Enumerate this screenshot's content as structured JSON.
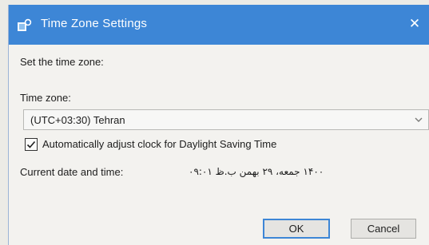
{
  "window": {
    "title": "Time Zone Settings",
    "close_glyph": "✕",
    "accent_color": "#3d86d6"
  },
  "content": {
    "heading": "Set the time zone:",
    "timezone_label": "Time zone:",
    "timezone_value": "(UTC+03:30) Tehran",
    "dst_label": "Automatically adjust clock for Daylight Saving Time",
    "dst_checked": true,
    "current_label": "Current date and time:",
    "current_value": "۱۴۰۰ جمعه، ۲۹ بهمن ب.ظ ۰۹:۰۱"
  },
  "buttons": {
    "ok": "OK",
    "cancel": "Cancel"
  },
  "icons": {
    "app": "time-zone-settings-icon",
    "close": "close-icon",
    "dropdown": "chevron-down-icon",
    "check": "checkmark-icon"
  }
}
